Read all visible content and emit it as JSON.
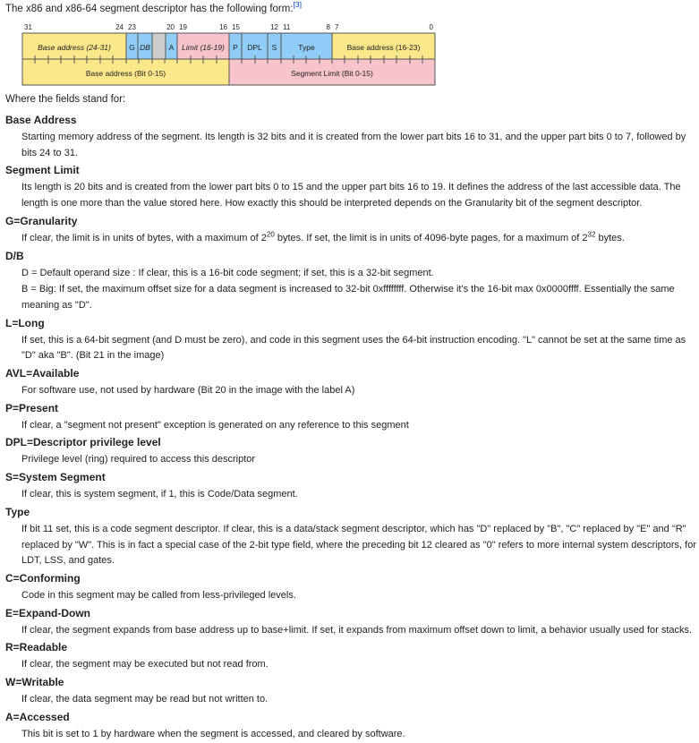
{
  "intro": {
    "text": "The x86 and x86-64 segment descriptor has the following form:",
    "ref": "[3]"
  },
  "diagram": {
    "bit_labels": [
      "31",
      "24",
      "23",
      "20",
      "19",
      "16",
      "15",
      "12",
      "11",
      "8",
      "7",
      "0"
    ],
    "upper_fields": [
      "Base address (24-31)",
      "G",
      "DB",
      "",
      "A",
      "Limit (16-19)",
      "P",
      "DPL",
      "S",
      "Type",
      "Base address (16-23)"
    ],
    "lower_fields": [
      "Base address (Bit 0-15)",
      "Segment Limit (Bit 0-15)"
    ],
    "colors": {
      "base": "#fbe88b",
      "flags": "#8fcdf7",
      "limit": "#f7c4cb",
      "reserved": "#cccccc"
    }
  },
  "where_text": "Where the fields stand for:",
  "defs": {
    "base_address": {
      "term": "Base Address",
      "desc": "Starting memory address of the segment. Its length is 32 bits and it is created from the lower part bits 16 to 31, and the upper part bits 0 to 7, followed by bits 24 to 31."
    },
    "segment_limit": {
      "term": "Segment Limit",
      "desc": "Its length is 20 bits and is created from the lower part bits 0 to 15 and the upper part bits 16 to 19. It defines the address of the last accessible data. The length is one more than the value stored here. How exactly this should be interpreted depends on the Granularity bit of the segment descriptor."
    },
    "granularity": {
      "term": "G=Granularity",
      "p1": "If clear, the limit is in units of bytes, with a maximum of 2",
      "e1": "20",
      "p2": " bytes. If set, the limit is in units of 4096-byte pages, for a maximum of 2",
      "e2": "32",
      "p3": " bytes."
    },
    "db": {
      "term": "D/B",
      "desc1": "D = Default operand size : If clear, this is a 16-bit code segment; if set, this is a 32-bit segment.",
      "desc2": "B = Big: If set, the maximum offset size for a data segment is increased to 32-bit 0xffffffff. Otherwise it's the 16-bit max 0x0000ffff. Essentially the same meaning as \"D\"."
    },
    "long": {
      "term": "L=Long",
      "desc": "If set, this is a 64-bit segment (and D must be zero), and code in this segment uses the 64-bit instruction encoding. \"L\" cannot be set at the same time as \"D\" aka \"B\". (Bit 21 in the image)"
    },
    "available": {
      "term": "AVL=Available",
      "desc": "For software use, not used by hardware (Bit 20 in the image with the label A)"
    },
    "present": {
      "term": "P=Present",
      "desc": "If clear, a \"segment not present\" exception is generated on any reference to this segment"
    },
    "dpl": {
      "term": "DPL=Descriptor privilege level",
      "desc": "Privilege level (ring) required to access this descriptor"
    },
    "system": {
      "term": "S=System Segment",
      "desc": "If clear, this is system segment, if 1, this is Code/Data segment."
    },
    "type": {
      "term": "Type",
      "desc": "If bit 11 set, this is a code segment descriptor. If clear, this is a data/stack segment descriptor, which has \"D\" replaced by \"B\", \"C\" replaced by \"E\" and \"R\" replaced by \"W\". This is in fact a special case of the 2-bit type field, where the preceding bit 12 cleared as \"0\" refers to more internal system descriptors, for LDT, LSS, and gates."
    },
    "conforming": {
      "term": "C=Conforming",
      "desc": "Code in this segment may be called from less-privileged levels."
    },
    "expand_down": {
      "term": "E=Expand-Down",
      "desc": "If clear, the segment expands from base address up to base+limit. If set, it expands from maximum offset down to limit, a behavior usually used for stacks."
    },
    "readable": {
      "term": "R=Readable",
      "desc": "If clear, the segment may be executed but not read from."
    },
    "writable": {
      "term": "W=Writable",
      "desc": "If clear, the data segment may be read but not written to."
    },
    "accessed": {
      "term": "A=Accessed",
      "desc": "This bit is set to 1 by hardware when the segment is accessed, and cleared by software."
    }
  }
}
